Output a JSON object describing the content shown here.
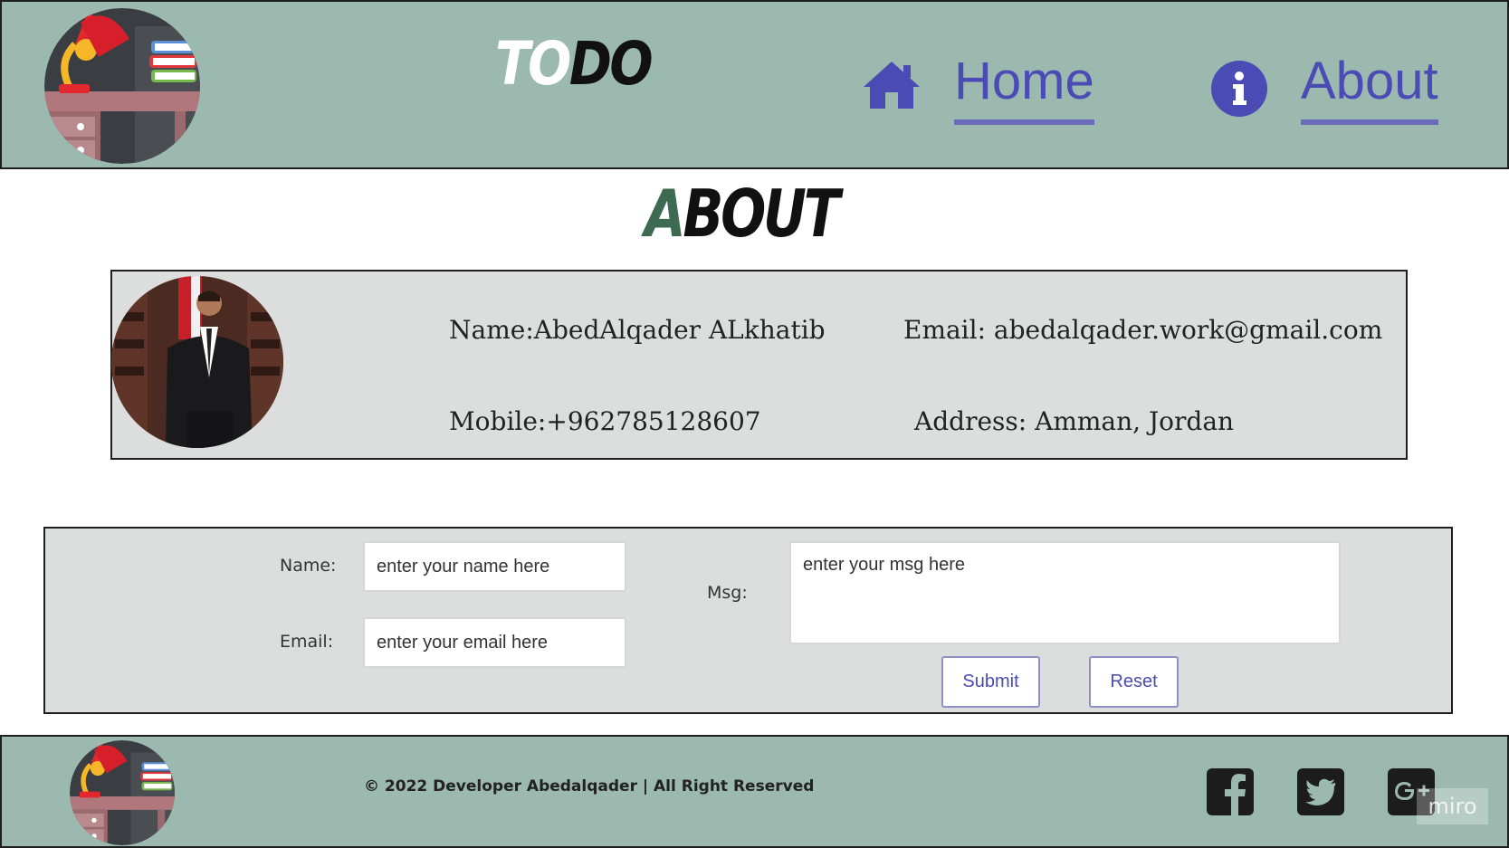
{
  "colors": {
    "header_bg": "#9bb9af",
    "link": "#4a4bb5",
    "card_bg": "#dcdedd",
    "title_accent": "#3d6b52"
  },
  "header": {
    "logo_icon": "desk-lamp-books-logo",
    "brand_white": "TO",
    "brand_dark": "DO",
    "nav": {
      "home": {
        "label": "Home",
        "icon": "home-icon"
      },
      "about": {
        "label": "About",
        "icon": "info-icon"
      }
    }
  },
  "page": {
    "title_first": "A",
    "title_rest": "BOUT"
  },
  "profile": {
    "name": "Name:AbedAlqader ALkhatib",
    "email": "Email: abedalqader.work@gmail.com",
    "mobile": "Mobile:+962785128607",
    "address": "Address: Amman, Jordan"
  },
  "contact_form": {
    "name_label": "Name:",
    "name_placeholder": "enter your name here",
    "email_label": "Email:",
    "email_placeholder": "enter your email here",
    "msg_label": "Msg:",
    "msg_placeholder": "enter your msg here",
    "submit_label": "Submit",
    "reset_label": "Reset"
  },
  "footer": {
    "copyright": "© 2022 Developer Abedalqader | All Right Reserved",
    "social": [
      "facebook-icon",
      "twitter-icon",
      "google-plus-icon"
    ],
    "watermark": "miro"
  }
}
